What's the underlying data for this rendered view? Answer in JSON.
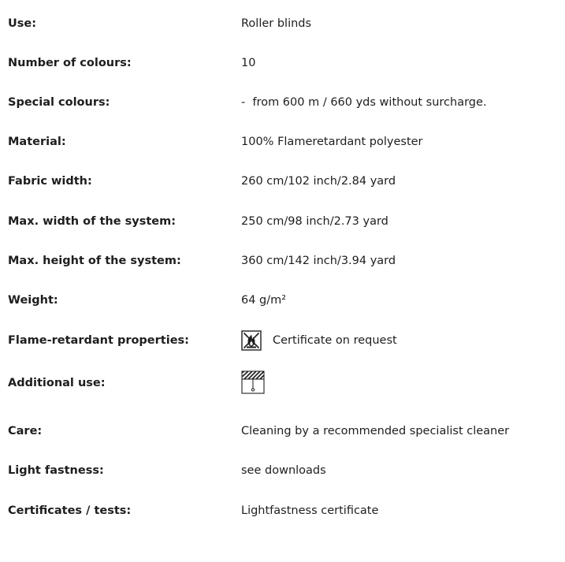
{
  "specs": [
    {
      "label": "Use:",
      "value": "Roller blinds"
    },
    {
      "label": "Number of colours:",
      "value": "10"
    },
    {
      "label": "Special colours:",
      "value": "-  from 600 m / 660 yds without surcharge."
    },
    {
      "label": "Material:",
      "value": "100% Flameretardant polyester"
    },
    {
      "label": "Fabric width:",
      "value": "260 cm/102 inch/2.84 yard"
    },
    {
      "label": "Max. width of the system:",
      "value": "250 cm/98 inch/2.73 yard"
    },
    {
      "label": "Max. height of the system:",
      "value": "360 cm/142 inch/3.94 yard"
    },
    {
      "label": "Weight:",
      "value": "64 g/m²"
    },
    {
      "label": "Flame-retardant properties:",
      "value": "Certificate on request",
      "icon": "flame-retardant-icon"
    },
    {
      "label": "Additional use:",
      "value": "",
      "icon": "roller-blind-icon"
    },
    {
      "label": "Care:",
      "value": "Cleaning by a recommended specialist cleaner"
    },
    {
      "label": "Light fastness:",
      "value": "see downloads"
    },
    {
      "label": "Certificates / tests:",
      "value": "Lightfastness certificate"
    }
  ],
  "colors": {
    "text": "#1e1e1e",
    "background": "#ffffff"
  }
}
